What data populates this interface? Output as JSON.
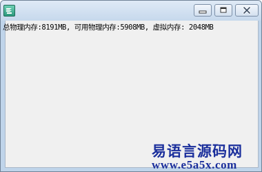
{
  "window": {
    "title": "",
    "controls": [
      "minimize",
      "maximize",
      "close"
    ]
  },
  "content": {
    "memory_info": "总物理内存:8191MB, 可用物理内存:5908MB, 虚拟内存: 2048MB"
  },
  "watermark": {
    "title": "易语言源码网",
    "url": "www.e5a5x.com"
  },
  "colors": {
    "titlebar": "#c6d8ec",
    "client_bg": "#f0f0f0",
    "watermark": "#1b2f9c"
  },
  "icons": {
    "app": "app-icon",
    "minimize": "minimize-icon",
    "maximize": "maximize-icon",
    "close": "close-icon"
  }
}
